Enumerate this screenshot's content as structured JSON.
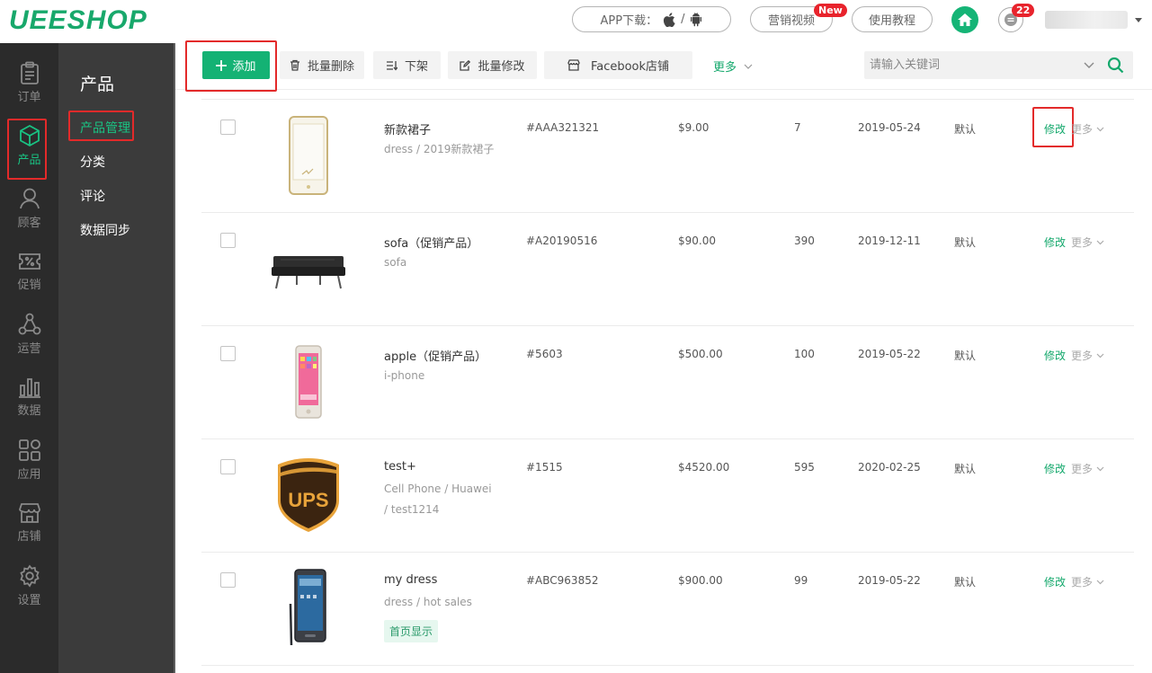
{
  "header": {
    "logo": "UEESHOP",
    "app_download": "APP下载：",
    "app_sep": "/",
    "marketing_video": "营销视频",
    "new_badge": "New",
    "tutorial": "使用教程",
    "message_count": "22"
  },
  "rail": [
    {
      "label": "订单",
      "icon": "clipboard-icon"
    },
    {
      "label": "产品",
      "icon": "cube-icon",
      "active": true
    },
    {
      "label": "顾客",
      "icon": "user-icon"
    },
    {
      "label": "促销",
      "icon": "coupon-icon"
    },
    {
      "label": "运营",
      "icon": "network-icon"
    },
    {
      "label": "数据",
      "icon": "bar-chart-icon"
    },
    {
      "label": "应用",
      "icon": "apps-icon"
    },
    {
      "label": "店铺",
      "icon": "store-icon"
    },
    {
      "label": "设置",
      "icon": "gear-icon"
    }
  ],
  "subnav": {
    "title": "产品",
    "items": [
      {
        "label": "产品管理",
        "active": true
      },
      {
        "label": "分类"
      },
      {
        "label": "评论"
      },
      {
        "label": "数据同步"
      }
    ]
  },
  "toolbar": {
    "add": "添加",
    "batch_delete": "批量删除",
    "unlist": "下架",
    "batch_edit": "批量修改",
    "facebook_store": "Facebook店铺",
    "more": "更多",
    "search_placeholder": "请输入关键词"
  },
  "products": [
    {
      "name": "新款裙子",
      "category": "dress / 2019新款裙子",
      "sku": "#AAA321321",
      "price": "$9.00",
      "stock": "7",
      "date": "2019-05-24",
      "group": "默认",
      "edit": "修改",
      "more": "更多",
      "thumb": "phone-case-image"
    },
    {
      "name": "sofa（促销产品）",
      "category": "sofa",
      "sku": "#A20190516",
      "price": "$90.00",
      "stock": "390",
      "date": "2019-12-11",
      "group": "默认",
      "edit": "修改",
      "more": "更多",
      "thumb": "sofa-image"
    },
    {
      "name": "apple（促销产品）",
      "category": "i-phone",
      "sku": "#5603",
      "price": "$500.00",
      "stock": "100",
      "date": "2019-05-22",
      "group": "默认",
      "edit": "修改",
      "more": "更多",
      "thumb": "smartphone-image"
    },
    {
      "name": "test+",
      "category": "Cell Phone / Huawei / test1214",
      "sku": "#1515",
      "price": "$4520.00",
      "stock": "595",
      "date": "2020-02-25",
      "group": "默认",
      "edit": "修改",
      "more": "更多",
      "thumb": "ups-logo-image"
    },
    {
      "name": "my dress",
      "category": "dress / hot sales",
      "tag": "首页显示",
      "sku": "#ABC963852",
      "price": "$900.00",
      "stock": "99",
      "date": "2019-05-22",
      "group": "默认",
      "edit": "修改",
      "more": "更多",
      "thumb": "galaxy-note-image"
    }
  ],
  "colors": {
    "accent": "#14b274",
    "highlight": "#e32a2a",
    "rail_bg": "#2b2b2b",
    "subnav_bg": "#3b3b3b",
    "danger": "#e8232c"
  }
}
